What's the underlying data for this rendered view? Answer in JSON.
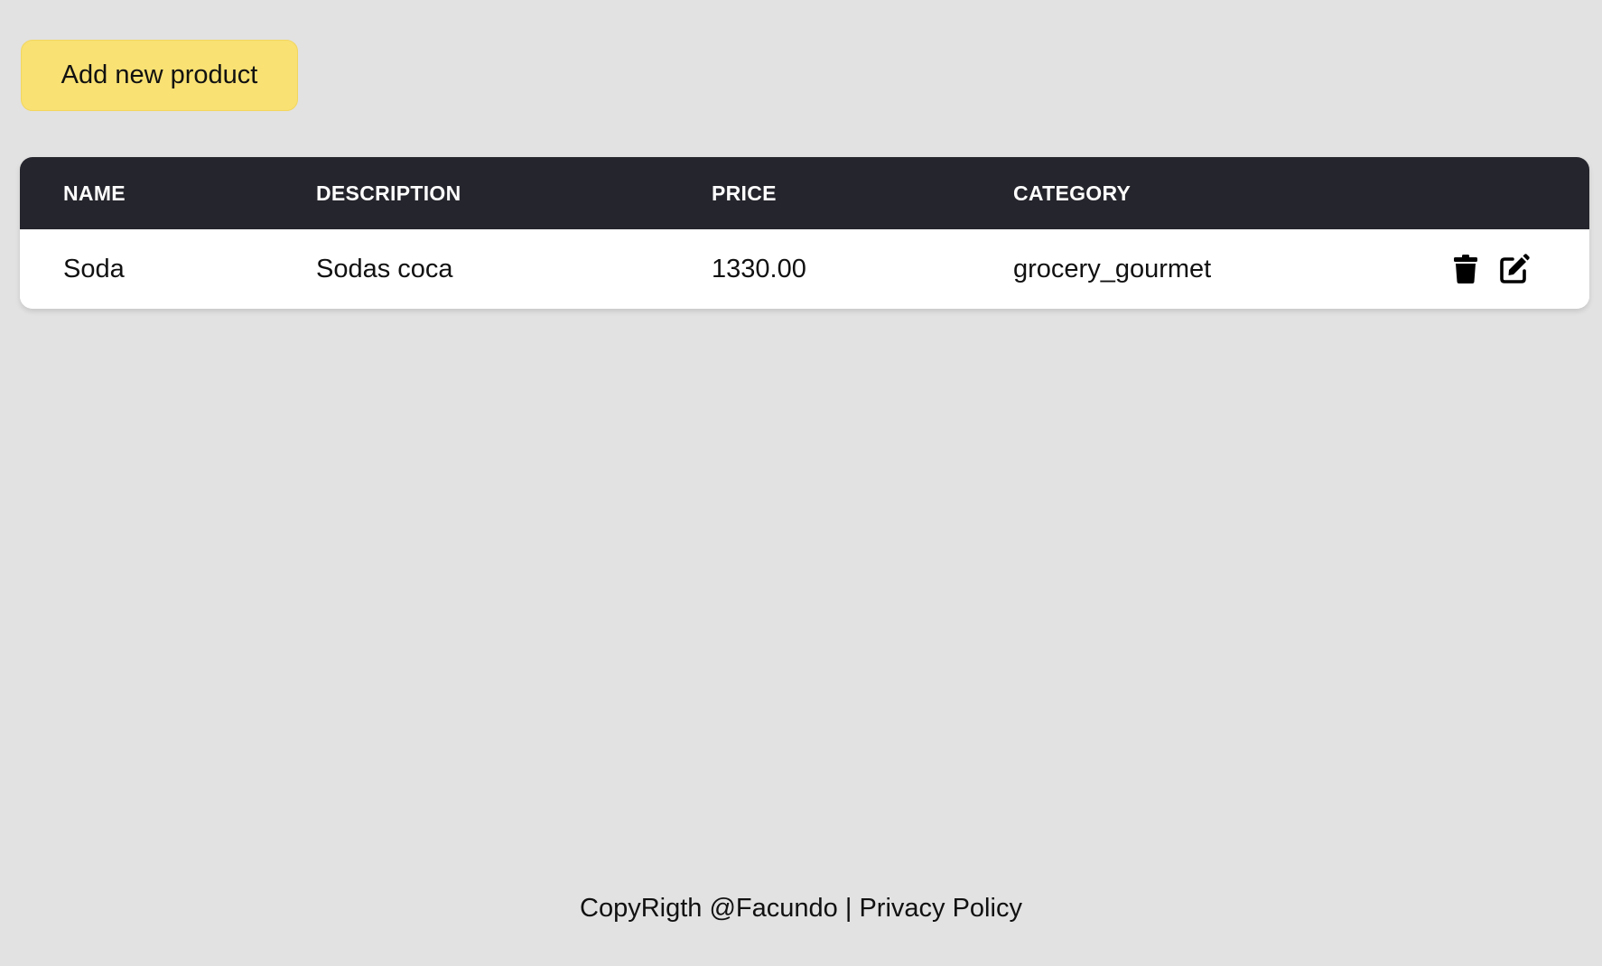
{
  "toolbar": {
    "add_label": "Add new product"
  },
  "table": {
    "headers": {
      "name": "NAME",
      "description": "DESCRIPTION",
      "price": "PRICE",
      "category": "CATEGORY"
    },
    "rows": [
      {
        "name": "Soda",
        "description": "Sodas coca",
        "price": "1330.00",
        "category": "grocery_gourmet",
        "actions": [
          "trash-icon",
          "edit-icon"
        ]
      }
    ]
  },
  "footer": {
    "copyright": "CopyRigth @Facundo",
    "separator": " | ",
    "privacy": "Privacy Policy"
  },
  "colors": {
    "background": "#e2e2e2",
    "accent_button": "#f9e173",
    "table_header": "#25252d",
    "table_body": "#ffffff"
  }
}
